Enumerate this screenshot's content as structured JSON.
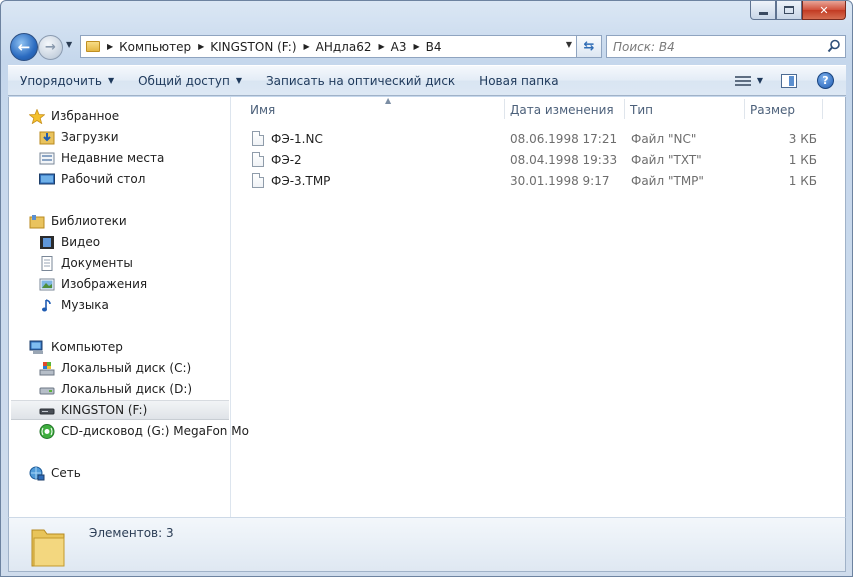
{
  "window": {
    "caption_buttons": [
      "minimize",
      "maximize",
      "close"
    ]
  },
  "navbar": {
    "breadcrumbs": [
      "Компьютер",
      "KINGSTON (F:)",
      "АНдла62",
      "А3",
      "В4"
    ],
    "search_placeholder": "Поиск: В4"
  },
  "toolbar": {
    "organize": "Упорядочить",
    "share": "Общий доступ",
    "burn": "Записать на оптический диск",
    "new_folder": "Новая папка"
  },
  "sidebar": {
    "favorites": {
      "label": "Избранное",
      "items": [
        "Загрузки",
        "Недавние места",
        "Рабочий стол"
      ]
    },
    "libraries": {
      "label": "Библиотеки",
      "items": [
        "Видео",
        "Документы",
        "Изображения",
        "Музыка"
      ]
    },
    "computer": {
      "label": "Компьютер",
      "items": [
        "Локальный диск (C:)",
        "Локальный диск (D:)",
        "KINGSTON (F:)",
        "CD-дисковод (G:) MegaFon Mo"
      ],
      "selected": "KINGSTON (F:)"
    },
    "network": {
      "label": "Сеть"
    }
  },
  "files": {
    "columns": [
      "Имя",
      "Дата изменения",
      "Тип",
      "Размер"
    ],
    "rows": [
      {
        "name": "ФЭ-1.NC",
        "date": "08.06.1998 17:21",
        "type": "Файл \"NC\"",
        "size": "3 КБ"
      },
      {
        "name": "ФЭ-2",
        "date": "08.04.1998 19:33",
        "type": "Файл \"TXT\"",
        "size": "1 КБ"
      },
      {
        "name": "ФЭ-3.TMP",
        "date": "30.01.1998 9:17",
        "type": "Файл \"TMP\"",
        "size": "1 КБ"
      }
    ]
  },
  "details": {
    "text": "Элементов: 3"
  },
  "colors": {
    "frame": "#c5d7ec",
    "accent": "#1f5cb2",
    "folder": "#e4b745"
  }
}
